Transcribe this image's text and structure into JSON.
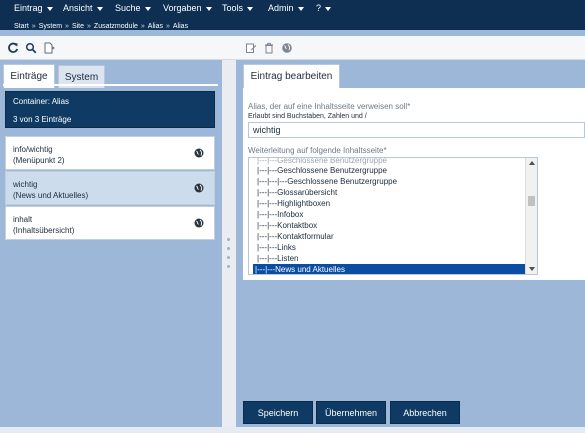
{
  "menu": {
    "items": [
      "Eintrag",
      "Ansicht",
      "Suche",
      "Vorgaben",
      "Tools",
      "Admin",
      "?"
    ]
  },
  "breadcrumb": [
    "Start",
    "System",
    "Site",
    "Zusatzmodule",
    "Alias",
    "Alias"
  ],
  "breadcrumb_separator": "»",
  "toolbar_left_icons": [
    "refresh-icon",
    "search-icon",
    "new-document-icon"
  ],
  "toolbar_right_icons": [
    "edit-icon",
    "trash-icon",
    "globe-icon"
  ],
  "left": {
    "tabs": [
      "Einträge",
      "System"
    ],
    "active_tab": "Einträge",
    "container_title": "Container: Alias",
    "container_count": "3 von 3 Einträge",
    "entries": [
      {
        "line1": "info/wichtig",
        "line2": "(Menüpunkt 2)",
        "selected": false
      },
      {
        "line1": "wichtig",
        "line2": "(News und Aktuelles)",
        "selected": true
      },
      {
        "line1": "inhalt",
        "line2": "(Inhaltsübersicht)",
        "selected": false
      }
    ]
  },
  "right": {
    "tab": "Eintrag bearbeiten",
    "alias_label": "Alias, der auf eine Inhaltsseite verweisen soll*",
    "alias_hint": "Erlaubt sind Buchstaben, Zahlen und /",
    "alias_value": "wichtig",
    "target_label": "Weiterleitung auf folgende Inhaltsseite*",
    "target_options": [
      "|---|---Geschlossene Benutzergruppe",
      "|---|---|---Geschlossene Benutzergruppe",
      "|---|---Glossarübersicht",
      "|---|---Highlightboxen",
      "|---|---Infobox",
      "|---|---Kontaktbox",
      "|---|---Kontaktformular",
      "|---|---Links",
      "|---|---Listen",
      "|---|---News und Aktuelles"
    ],
    "selected_target": "|---|---News und Aktuelles"
  },
  "buttons": {
    "save": "Speichern",
    "apply": "Übernehmen",
    "cancel": "Abbrechen"
  },
  "colors": {
    "navy": "#0e2f52",
    "panel_blue": "#9db7d9",
    "selected_row": "#0a4ea3"
  }
}
